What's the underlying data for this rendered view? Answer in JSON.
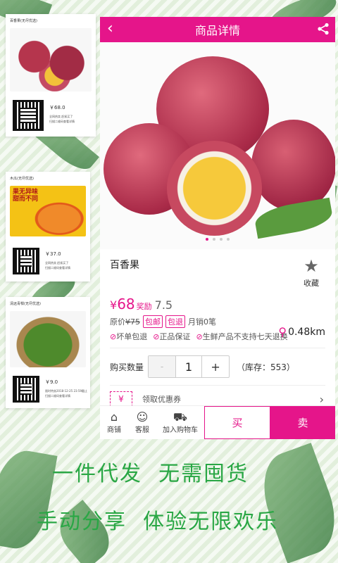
{
  "posters": [
    {
      "title": "百香果(无尽优选)",
      "price": "￥68.0",
      "note1": "全网热卖 赶紧买了",
      "note2": "扫描二维码查看详情"
    },
    {
      "title": "木瓜(无尽优选)",
      "banner": "果无异味 甜而不同",
      "price": "￥37.0",
      "note1": "全网热卖 赶紧买了",
      "note2": "扫描二维码查看详情"
    },
    {
      "title": "清远青柑(无尽优选)",
      "price": "￥9.0",
      "note1": "限时特卖2018-12-25 23:59截止",
      "note2": "扫描二维码查看详情"
    }
  ],
  "header": {
    "title": "商品详情",
    "back_icon": "chevron-left-icon",
    "share_icon": "share-icon"
  },
  "product": {
    "name": "百香果",
    "favorite_label": "收藏",
    "price_currency": "¥",
    "price": "68",
    "reward_label": "奖励",
    "reward": "7.5",
    "distance": "0.48km",
    "original_price_label": "原价",
    "original_price": "¥75",
    "tags": [
      "包邮",
      "包退"
    ],
    "monthly_sales": "月销0笔",
    "guarantees": [
      "坏单包退",
      "正品保证",
      "生鲜产品不支持七天退换"
    ]
  },
  "quantity": {
    "label": "购买数量",
    "minus": "-",
    "value": "1",
    "plus": "+",
    "stock": "（库存：553）"
  },
  "coupon": {
    "label": "领取优惠券",
    "icon_text": "¥"
  },
  "bottom_bar": {
    "shop": "商铺",
    "service": "客服",
    "add_cart": "加入购物车",
    "buy": "买",
    "sell": "卖"
  },
  "slogans": [
    "一件代发  无需囤货",
    "手动分享  体验无限欢乐"
  ],
  "colors": {
    "accent": "#e5158a",
    "slogan": "#2aa745"
  }
}
